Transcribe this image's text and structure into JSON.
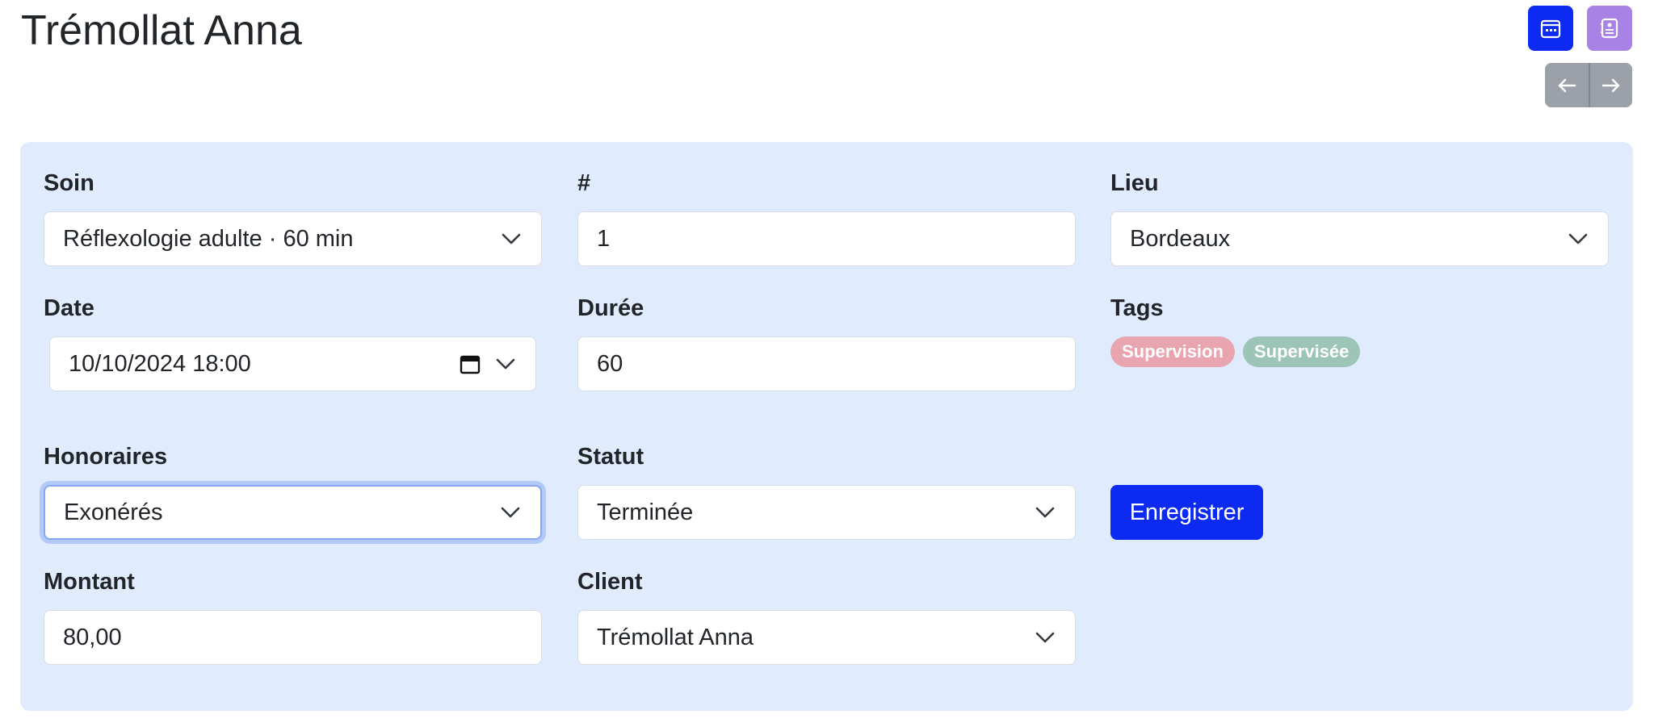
{
  "header": {
    "title": "Trémollat Anna",
    "buttons": [
      {
        "icon": "calendar-icon",
        "color": "#0d2af2"
      },
      {
        "icon": "contact-book-icon",
        "color": "#a982e6"
      }
    ],
    "nav": [
      {
        "icon": "arrow-left-icon"
      },
      {
        "icon": "arrow-right-icon"
      }
    ]
  },
  "form": {
    "soin": {
      "label": "Soin",
      "value": "Réflexologie adulte · 60 min"
    },
    "number": {
      "label": "#",
      "value": "1"
    },
    "lieu": {
      "label": "Lieu",
      "value": "Bordeaux"
    },
    "date": {
      "label": "Date",
      "value": "10/10/2024 18:00"
    },
    "duree": {
      "label": "Durée",
      "value": "60"
    },
    "tags": {
      "label": "Tags",
      "items": [
        {
          "label": "Supervision",
          "color": "#e8a5b0"
        },
        {
          "label": "Supervisée",
          "color": "#9cc5b8"
        }
      ]
    },
    "honoraires": {
      "label": "Honoraires",
      "value": "Exonérés"
    },
    "statut": {
      "label": "Statut",
      "value": "Terminée"
    },
    "montant": {
      "label": "Montant",
      "value": "80,00"
    },
    "client": {
      "label": "Client",
      "value": "Trémollat Anna"
    },
    "save_label": "Enregistrer"
  },
  "colors": {
    "accent": "#0d2af2",
    "panel": "#e0ebfd"
  }
}
